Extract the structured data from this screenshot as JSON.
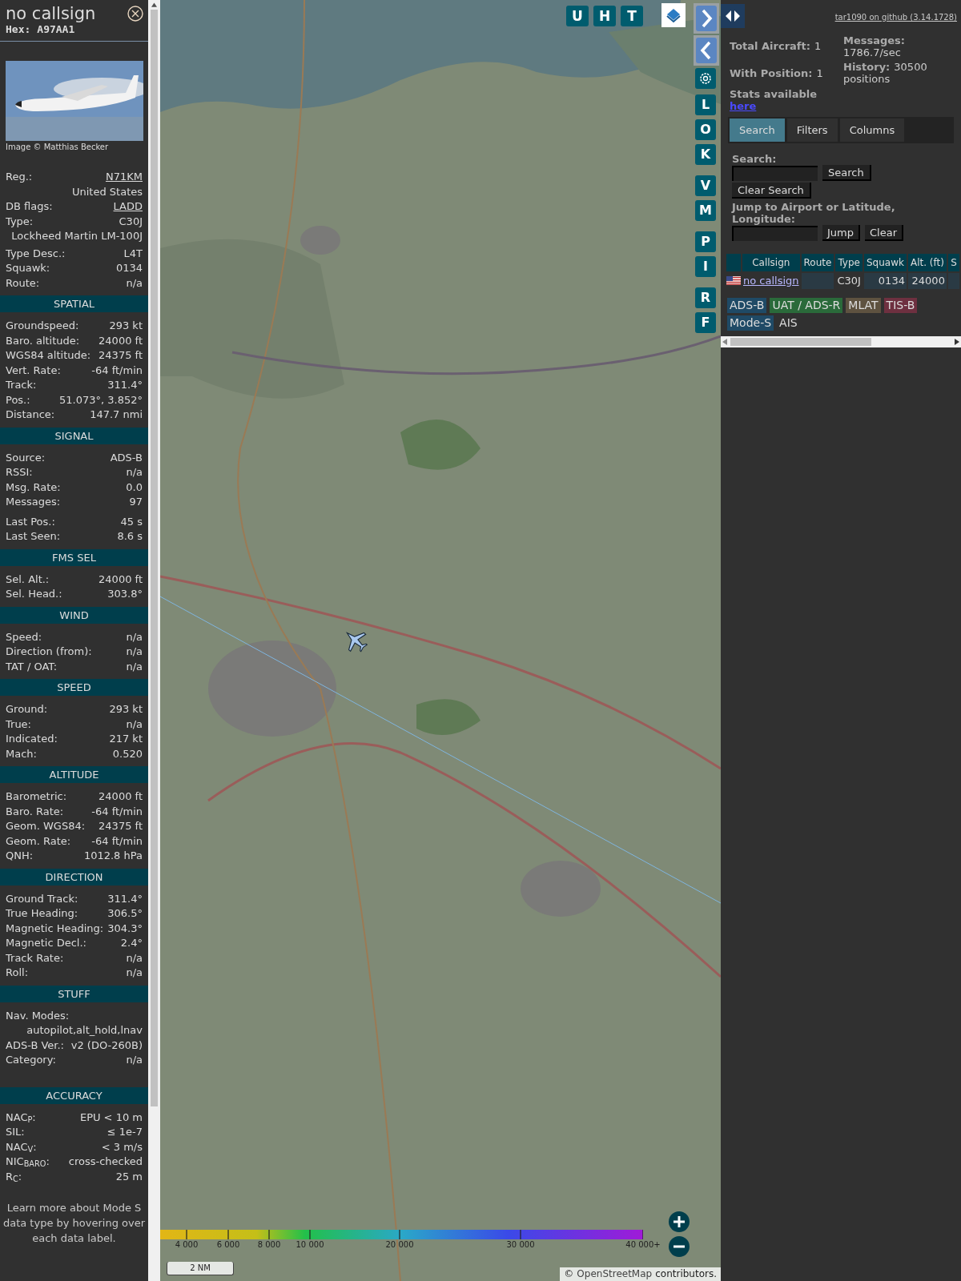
{
  "detail": {
    "callsign": "no callsign",
    "hex_label": "Hex:",
    "hex": "A97AA1",
    "photo_credit": "Image © Matthias Becker",
    "rows": [
      {
        "label": "Reg.:",
        "value": "N71KM",
        "link": true
      },
      {
        "value": "United States",
        "link": false
      },
      {
        "label": "DB flags:",
        "value": "LADD",
        "link": true
      },
      {
        "label": "Type:",
        "value": "C30J",
        "link": false
      },
      {
        "value": "Lockheed Martin LM-100J",
        "link": false
      },
      {
        "label": "Type Desc.:",
        "value": "L4T",
        "link": false
      },
      {
        "label": "Squawk:",
        "value": "0134",
        "link": false
      },
      {
        "label": "Route:",
        "value": "n/a",
        "link": false
      }
    ],
    "sections": [
      {
        "title": "SPATIAL",
        "rows": [
          {
            "label": "Groundspeed:",
            "value": "293 kt"
          },
          {
            "label": "Baro. altitude:",
            "value": "24000 ft"
          },
          {
            "label": "WGS84 altitude:",
            "value": "24375 ft"
          },
          {
            "label": "Vert. Rate:",
            "value": "-64 ft/min"
          },
          {
            "label": "Track:",
            "value": "311.4°"
          },
          {
            "label": "Pos.:",
            "value": "51.073°, 3.852°"
          },
          {
            "label": "Distance:",
            "value": "147.7 nmi"
          }
        ]
      },
      {
        "title": "SIGNAL",
        "rows": [
          {
            "label": "Source:",
            "value": "ADS-B"
          },
          {
            "label": "RSSI:",
            "value": "n/a"
          },
          {
            "label": "Msg. Rate:",
            "value": "0.0"
          },
          {
            "label": "Messages:",
            "value": "97"
          },
          {
            "label": "Last Pos.:",
            "value": "45 s"
          },
          {
            "label": "Last Seen:",
            "value": "8.6 s"
          }
        ]
      },
      {
        "title": "FMS SEL",
        "rows": [
          {
            "label": "Sel. Alt.:",
            "value": "24000 ft"
          },
          {
            "label": "Sel. Head.:",
            "value": "303.8°"
          }
        ]
      },
      {
        "title": "WIND",
        "rows": [
          {
            "label": "Speed:",
            "value": "n/a"
          },
          {
            "label": "Direction (from):",
            "value": "n/a"
          },
          {
            "label": "TAT / OAT:",
            "value": "n/a"
          }
        ]
      },
      {
        "title": "SPEED",
        "rows": [
          {
            "label": "Ground:",
            "value": "293 kt"
          },
          {
            "label": "True:",
            "value": "n/a"
          },
          {
            "label": "Indicated:",
            "value": "217 kt"
          },
          {
            "label": "Mach:",
            "value": "0.520"
          }
        ]
      },
      {
        "title": "ALTITUDE",
        "rows": [
          {
            "label": "Barometric:",
            "value": "24000 ft"
          },
          {
            "label": "Baro. Rate:",
            "value": "-64 ft/min"
          },
          {
            "label": "Geom. WGS84:",
            "value": "24375 ft"
          },
          {
            "label": "Geom. Rate:",
            "value": "-64 ft/min"
          },
          {
            "label": "QNH:",
            "value": "1012.8 hPa"
          }
        ]
      },
      {
        "title": "DIRECTION",
        "rows": [
          {
            "label": "Ground Track:",
            "value": "311.4°"
          },
          {
            "label": "True Heading:",
            "value": "306.5°"
          },
          {
            "label": "Magnetic Heading:",
            "value": "304.3°"
          },
          {
            "label": "Magnetic Decl.:",
            "value": "2.4°"
          },
          {
            "label": "Track Rate:",
            "value": "n/a"
          },
          {
            "label": "Roll:",
            "value": "n/a"
          }
        ]
      },
      {
        "title": "STUFF",
        "rows": [
          {
            "label": "Nav. Modes:"
          },
          {
            "value": "autopilot,alt_hold,lnav"
          },
          {
            "label": "ADS-B Ver.:",
            "value": "v2 (DO-260B)"
          },
          {
            "label": "Category:",
            "value": "n/a"
          }
        ]
      },
      {
        "title": "ACCURACY",
        "rows": [
          {
            "label": "NAC$_{P}$:",
            "value": "EPU < 10 m"
          },
          {
            "label": "SIL:",
            "value": "≤ 1e-7"
          },
          {
            "label": "NAC$_{V}$:",
            "value": "< 3 m/s"
          },
          {
            "label": "NIC$_{BARO}$:",
            "value": "cross-checked"
          },
          {
            "label": "R$_{C}$:",
            "value": "25 m"
          }
        ]
      }
    ],
    "note": "Learn more about Mode S data type by hovering over each data label."
  },
  "map": {
    "top_buttons": [
      "U",
      "H",
      "T"
    ],
    "side_buttons": [
      "L",
      "O",
      "K",
      "V",
      "M",
      "P",
      "I",
      "R",
      "F"
    ],
    "legend_ticks": [
      "4 000",
      "6 000",
      "8 000",
      "10 000",
      "20 000",
      "30 000",
      "40 000+"
    ],
    "scale": "2 NM",
    "attribution_prefix": "©",
    "attribution_link": "OpenStreetMap",
    "attribution_suffix": "contributors."
  },
  "panel": {
    "github_link": "tar1090 on github (3.14.1728)",
    "stats_left": [
      {
        "label": "Total Aircraft:",
        "value": "1"
      },
      {
        "label": "With Position:",
        "value": "1"
      }
    ],
    "stats_link_label": "Stats available",
    "stats_link": "here",
    "stats_right": [
      {
        "label": "Messages:",
        "value": "1786.7/sec"
      },
      {
        "label": "History:",
        "value": "30500 positions"
      }
    ],
    "tabs": [
      {
        "label": "Search",
        "selected": true
      },
      {
        "label": "Filters",
        "selected": false
      },
      {
        "label": "Columns",
        "selected": false
      }
    ],
    "search_label": "Search:",
    "search_button": "Search",
    "clear_search_button": "Clear Search",
    "jump_label": "Jump to Airport or Latitude, Longitude:",
    "jump_button": "Jump",
    "clear_button": "Clear",
    "table": {
      "columns": [
        "Callsign",
        "Route",
        "Type",
        "Squawk",
        "Alt. (ft)",
        "S"
      ],
      "rows": [
        {
          "callsign": "no callsign",
          "type": "C30J",
          "squawk": "0134",
          "altitude": "24000"
        }
      ]
    },
    "sources": [
      {
        "label": "ADS-B",
        "color": "#1f4a66"
      },
      {
        "label": "UAT / ADS-R",
        "color": "#2a6a3a"
      },
      {
        "label": "MLAT",
        "color": "#5e5240"
      },
      {
        "label": "TIS-B",
        "color": "#6e3040"
      },
      {
        "label": "Mode-S",
        "color": "#1f4a66"
      },
      {
        "label": "AIS",
        "color": "#303030"
      }
    ]
  }
}
